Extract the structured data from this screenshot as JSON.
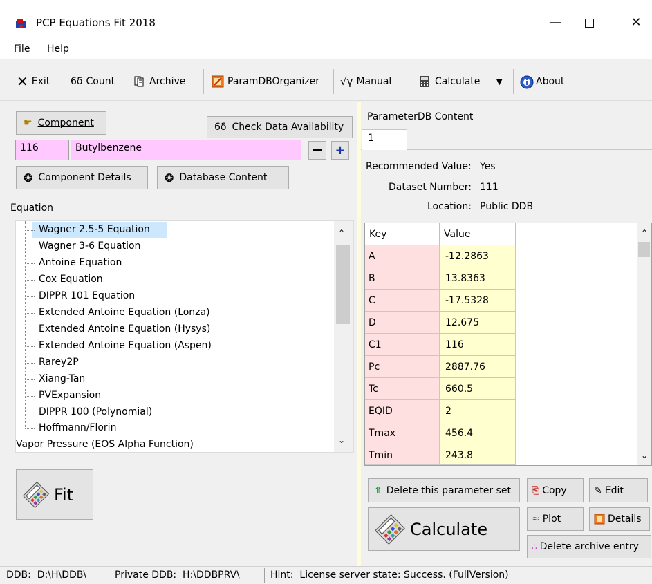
{
  "window": {
    "title": "PCP Equations Fit 2018"
  },
  "menu": [
    "File",
    "Help"
  ],
  "toolbar": {
    "exit": "Exit",
    "count": "Count",
    "archive": "Archive",
    "paramdb": "ParamDBOrganizer",
    "manual": "Manual",
    "calculate": "Calculate",
    "about": "About"
  },
  "left": {
    "component_button": "Component",
    "check_data_button": "Check Data Availability",
    "component_id": "116",
    "component_name": "Butylbenzene",
    "component_details_button": "Component Details",
    "database_content_button": "Database Content",
    "equation_label": "Equation",
    "equations": [
      "Wagner 2.5-5 Equation",
      "Wagner 3-6 Equation",
      "Antoine Equation",
      "Cox Equation",
      "DIPPR 101 Equation",
      "Extended Antoine Equation (Lonza)",
      "Extended Antoine Equation (Hysys)",
      "Extended Antoine Equation (Aspen)",
      "Rarey2P",
      "Xiang-Tan",
      "PVExpansion",
      "DIPPR 100 (Polynomial)",
      "Hoffmann/Florin"
    ],
    "group_next": "Vapor Pressure (EOS Alpha Function)",
    "fit_button": "Fit"
  },
  "right": {
    "section_title": "ParameterDB Content",
    "tab": "1",
    "recommended_label": "Recommended Value:",
    "recommended_value": "Yes",
    "dataset_label": "Dataset Number:",
    "dataset_value": "111",
    "location_label": "Location:",
    "location_value": "Public DDB",
    "table": {
      "headers": [
        "Key",
        "Value"
      ],
      "rows": [
        [
          "A",
          "-12.2863"
        ],
        [
          "B",
          "13.8363"
        ],
        [
          "C",
          "-17.5328"
        ],
        [
          "D",
          "12.675"
        ],
        [
          "C1",
          "116"
        ],
        [
          "Pc",
          "2887.76"
        ],
        [
          "Tc",
          "660.5"
        ],
        [
          "EQID",
          "2"
        ],
        [
          "Tmax",
          "456.4"
        ],
        [
          "Tmin",
          "243.8"
        ]
      ]
    },
    "delete_param_button": "Delete this parameter set",
    "copy_button": "Copy",
    "edit_button": "Edit",
    "calculate_button": "Calculate",
    "plot_button": "Plot",
    "details_button": "Details",
    "delete_archive_button": "Delete archive entry"
  },
  "status": {
    "ddb_label": "DDB:",
    "ddb_path": "D:\\H\\DDB\\",
    "private_label": "Private DDB:",
    "private_path": "H:\\DDBPRV\\",
    "hint_label": "Hint:",
    "hint_text": "License server state: Success. (FullVersion)"
  },
  "colors": {
    "field_pink": "#ffc8ff",
    "key_cell": "#ffe0e0",
    "value_cell": "#ffffd0",
    "selection": "#cce8ff"
  }
}
